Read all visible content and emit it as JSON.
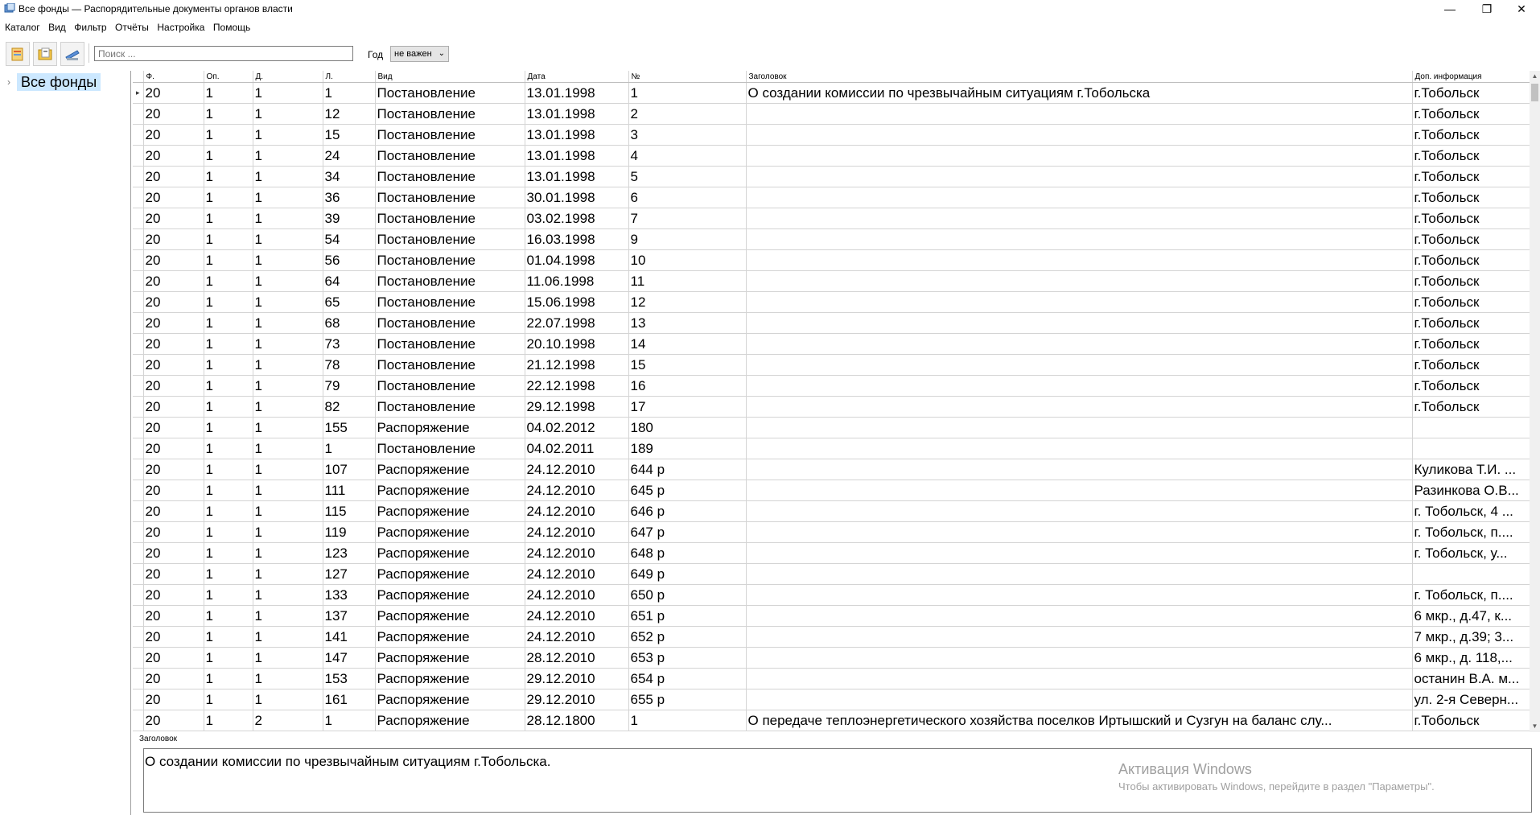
{
  "window": {
    "title": "Все фонды — Распорядительные документы органов власти",
    "controls": {
      "minimize": "—",
      "restore": "❐",
      "close": "✕"
    }
  },
  "menu": [
    "Каталог",
    "Вид",
    "Фильтр",
    "Отчёты",
    "Настройка",
    "Помощь"
  ],
  "toolbar": {
    "buttons": [
      "new-document-icon",
      "open-folder-icon",
      "scanner-icon"
    ],
    "search_placeholder": "Поиск ...",
    "year_label": "Год",
    "year_value": "не важен"
  },
  "tree": {
    "root_label": "Все фонды",
    "expander": "›"
  },
  "grid": {
    "columns": [
      "Ф.",
      "Оп.",
      "Д.",
      "Л.",
      "Вид",
      "Дата",
      "№",
      "Заголовок",
      "Доп. информация"
    ],
    "current_row_marker": "▸",
    "rows": [
      [
        "20",
        "1",
        "1",
        "1",
        "Постановление",
        "13.01.1998",
        "1",
        "О создании комиссии по чрезвычайным ситуациям г.Тобольска",
        "г.Тобольск"
      ],
      [
        "20",
        "1",
        "1",
        "12",
        "Постановление",
        "13.01.1998",
        "2",
        "",
        "г.Тобольск"
      ],
      [
        "20",
        "1",
        "1",
        "15",
        "Постановление",
        "13.01.1998",
        "3",
        "",
        "г.Тобольск"
      ],
      [
        "20",
        "1",
        "1",
        "24",
        "Постановление",
        "13.01.1998",
        "4",
        "",
        "г.Тобольск"
      ],
      [
        "20",
        "1",
        "1",
        "34",
        "Постановление",
        "13.01.1998",
        "5",
        "",
        "г.Тобольск"
      ],
      [
        "20",
        "1",
        "1",
        "36",
        "Постановление",
        "30.01.1998",
        "6",
        "",
        "г.Тобольск"
      ],
      [
        "20",
        "1",
        "1",
        "39",
        "Постановление",
        "03.02.1998",
        "7",
        "",
        "г.Тобольск"
      ],
      [
        "20",
        "1",
        "1",
        "54",
        "Постановление",
        "16.03.1998",
        "9",
        "",
        "г.Тобольск"
      ],
      [
        "20",
        "1",
        "1",
        "56",
        "Постановление",
        "01.04.1998",
        "10",
        "",
        "г.Тобольск"
      ],
      [
        "20",
        "1",
        "1",
        "64",
        "Постановление",
        "11.06.1998",
        "11",
        "",
        "г.Тобольск"
      ],
      [
        "20",
        "1",
        "1",
        "65",
        "Постановление",
        "15.06.1998",
        "12",
        "",
        "г.Тобольск"
      ],
      [
        "20",
        "1",
        "1",
        "68",
        "Постановление",
        "22.07.1998",
        "13",
        "",
        "г.Тобольск"
      ],
      [
        "20",
        "1",
        "1",
        "73",
        "Постановление",
        "20.10.1998",
        "14",
        "",
        "г.Тобольск"
      ],
      [
        "20",
        "1",
        "1",
        "78",
        "Постановление",
        "21.12.1998",
        "15",
        "",
        "г.Тобольск"
      ],
      [
        "20",
        "1",
        "1",
        "79",
        "Постановление",
        "22.12.1998",
        "16",
        "",
        "г.Тобольск"
      ],
      [
        "20",
        "1",
        "1",
        "82",
        "Постановление",
        "29.12.1998",
        "17",
        "",
        "г.Тобольск"
      ],
      [
        "20",
        "1",
        "1",
        "155",
        "Распоряжение",
        "04.02.2012",
        "180",
        "",
        ""
      ],
      [
        "20",
        "1",
        "1",
        "1",
        "Постановление",
        "04.02.2011",
        "189",
        "",
        ""
      ],
      [
        "20",
        "1",
        "1",
        "107",
        "Распоряжение",
        "24.12.2010",
        "644  р",
        "",
        "Куликова Т.И. ..."
      ],
      [
        "20",
        "1",
        "1",
        "111",
        "Распоряжение",
        "24.12.2010",
        "645 р",
        "",
        "Разинкова О.В..."
      ],
      [
        "20",
        "1",
        "1",
        "115",
        "Распоряжение",
        "24.12.2010",
        "646 р",
        "",
        "г. Тобольск, 4 ..."
      ],
      [
        "20",
        "1",
        "1",
        "119",
        "Распоряжение",
        "24.12.2010",
        "647 р",
        "",
        "г. Тобольск, п...."
      ],
      [
        "20",
        "1",
        "1",
        "123",
        "Распоряжение",
        "24.12.2010",
        "648 р",
        "",
        "г. Тобольск, у..."
      ],
      [
        "20",
        "1",
        "1",
        "127",
        "Распоряжение",
        "24.12.2010",
        "649 р",
        "",
        ""
      ],
      [
        "20",
        "1",
        "1",
        "133",
        "Распоряжение",
        "24.12.2010",
        "650 р",
        "",
        "г. Тобольск, п...."
      ],
      [
        "20",
        "1",
        "1",
        "137",
        "Распоряжение",
        "24.12.2010",
        "651 р",
        "",
        "6 мкр., д.47, к..."
      ],
      [
        "20",
        "1",
        "1",
        "141",
        "Распоряжение",
        "24.12.2010",
        "652 р",
        "",
        "7 мкр., д.39; 3..."
      ],
      [
        "20",
        "1",
        "1",
        "147",
        "Распоряжение",
        "28.12.2010",
        "653 р",
        "",
        "6 мкр., д. 118,..."
      ],
      [
        "20",
        "1",
        "1",
        "153",
        "Распоряжение",
        "29.12.2010",
        "654 р",
        "",
        "останин В.А. м..."
      ],
      [
        "20",
        "1",
        "1",
        "161",
        "Распоряжение",
        "29.12.2010",
        "655 р",
        "",
        "ул. 2-я Северн..."
      ],
      [
        "20",
        "1",
        "2",
        "1",
        "Распоряжение",
        "28.12.1800",
        "1",
        "О передаче теплоэнергетического хозяйства поселков Иртышский и Сузгун на баланс слу...",
        "г.Тобольск"
      ]
    ]
  },
  "detail": {
    "label": "Заголовок",
    "text": "О создании комиссии по чрезвычайным ситуациям г.Тобольска."
  },
  "watermark": {
    "line1": "Активация Windows",
    "line2": "Чтобы активировать Windows, перейдите в раздел \"Параметры\"."
  }
}
